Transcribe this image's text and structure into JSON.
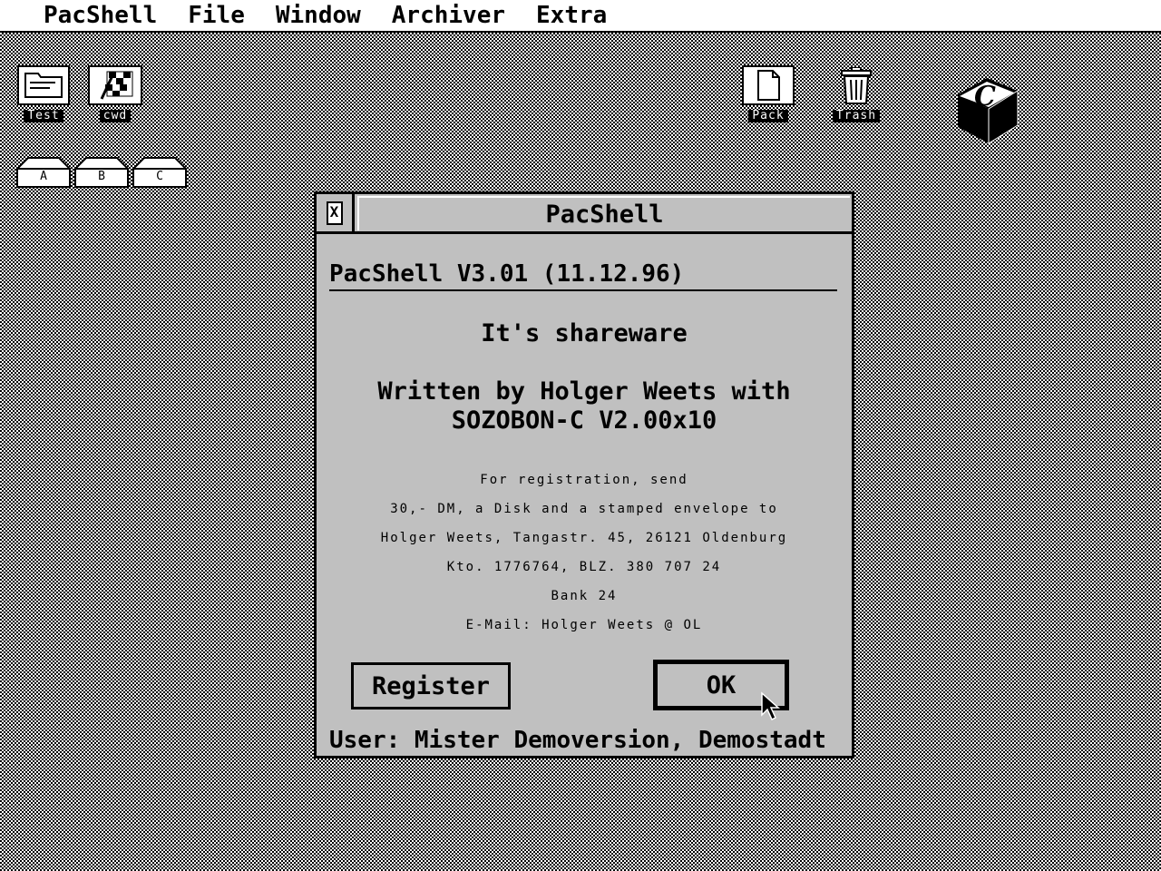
{
  "menubar": {
    "items": [
      "PacShell",
      "File",
      "Window",
      "Archiver",
      "Extra"
    ]
  },
  "desktop": {
    "icons": [
      {
        "label": "Test",
        "icon": "folder-icon"
      },
      {
        "label": "cwd",
        "icon": "checkered-flag-icon"
      },
      {
        "label": "Pack",
        "icon": "document-icon"
      },
      {
        "label": "Trash",
        "icon": "trash-icon"
      }
    ],
    "drives": [
      "A",
      "B",
      "C"
    ],
    "logo_letter": "C"
  },
  "dialog": {
    "title": "PacShell",
    "close_glyph": "X",
    "version": "PacShell V3.01 (11.12.96)",
    "shareware": "It's shareware",
    "written_by_1": "Written by Holger Weets with",
    "written_by_2": "SOZOBON-C V2.00x10",
    "registration_lines": [
      "For registration, send",
      "30,- DM, a Disk and a stamped envelope to",
      "Holger Weets, Tangastr. 45, 26121 Oldenburg",
      "Kto. 1776764, BLZ. 380 707 24",
      "Bank 24",
      "E-Mail: Holger Weets @ OL"
    ],
    "register_label": "Register",
    "ok_label": "OK",
    "user_line": "User: Mister Demoversion, Demostadt"
  },
  "colors": {
    "dialog_bg": "#c0c0c0",
    "desktop_pattern": "#000000"
  }
}
